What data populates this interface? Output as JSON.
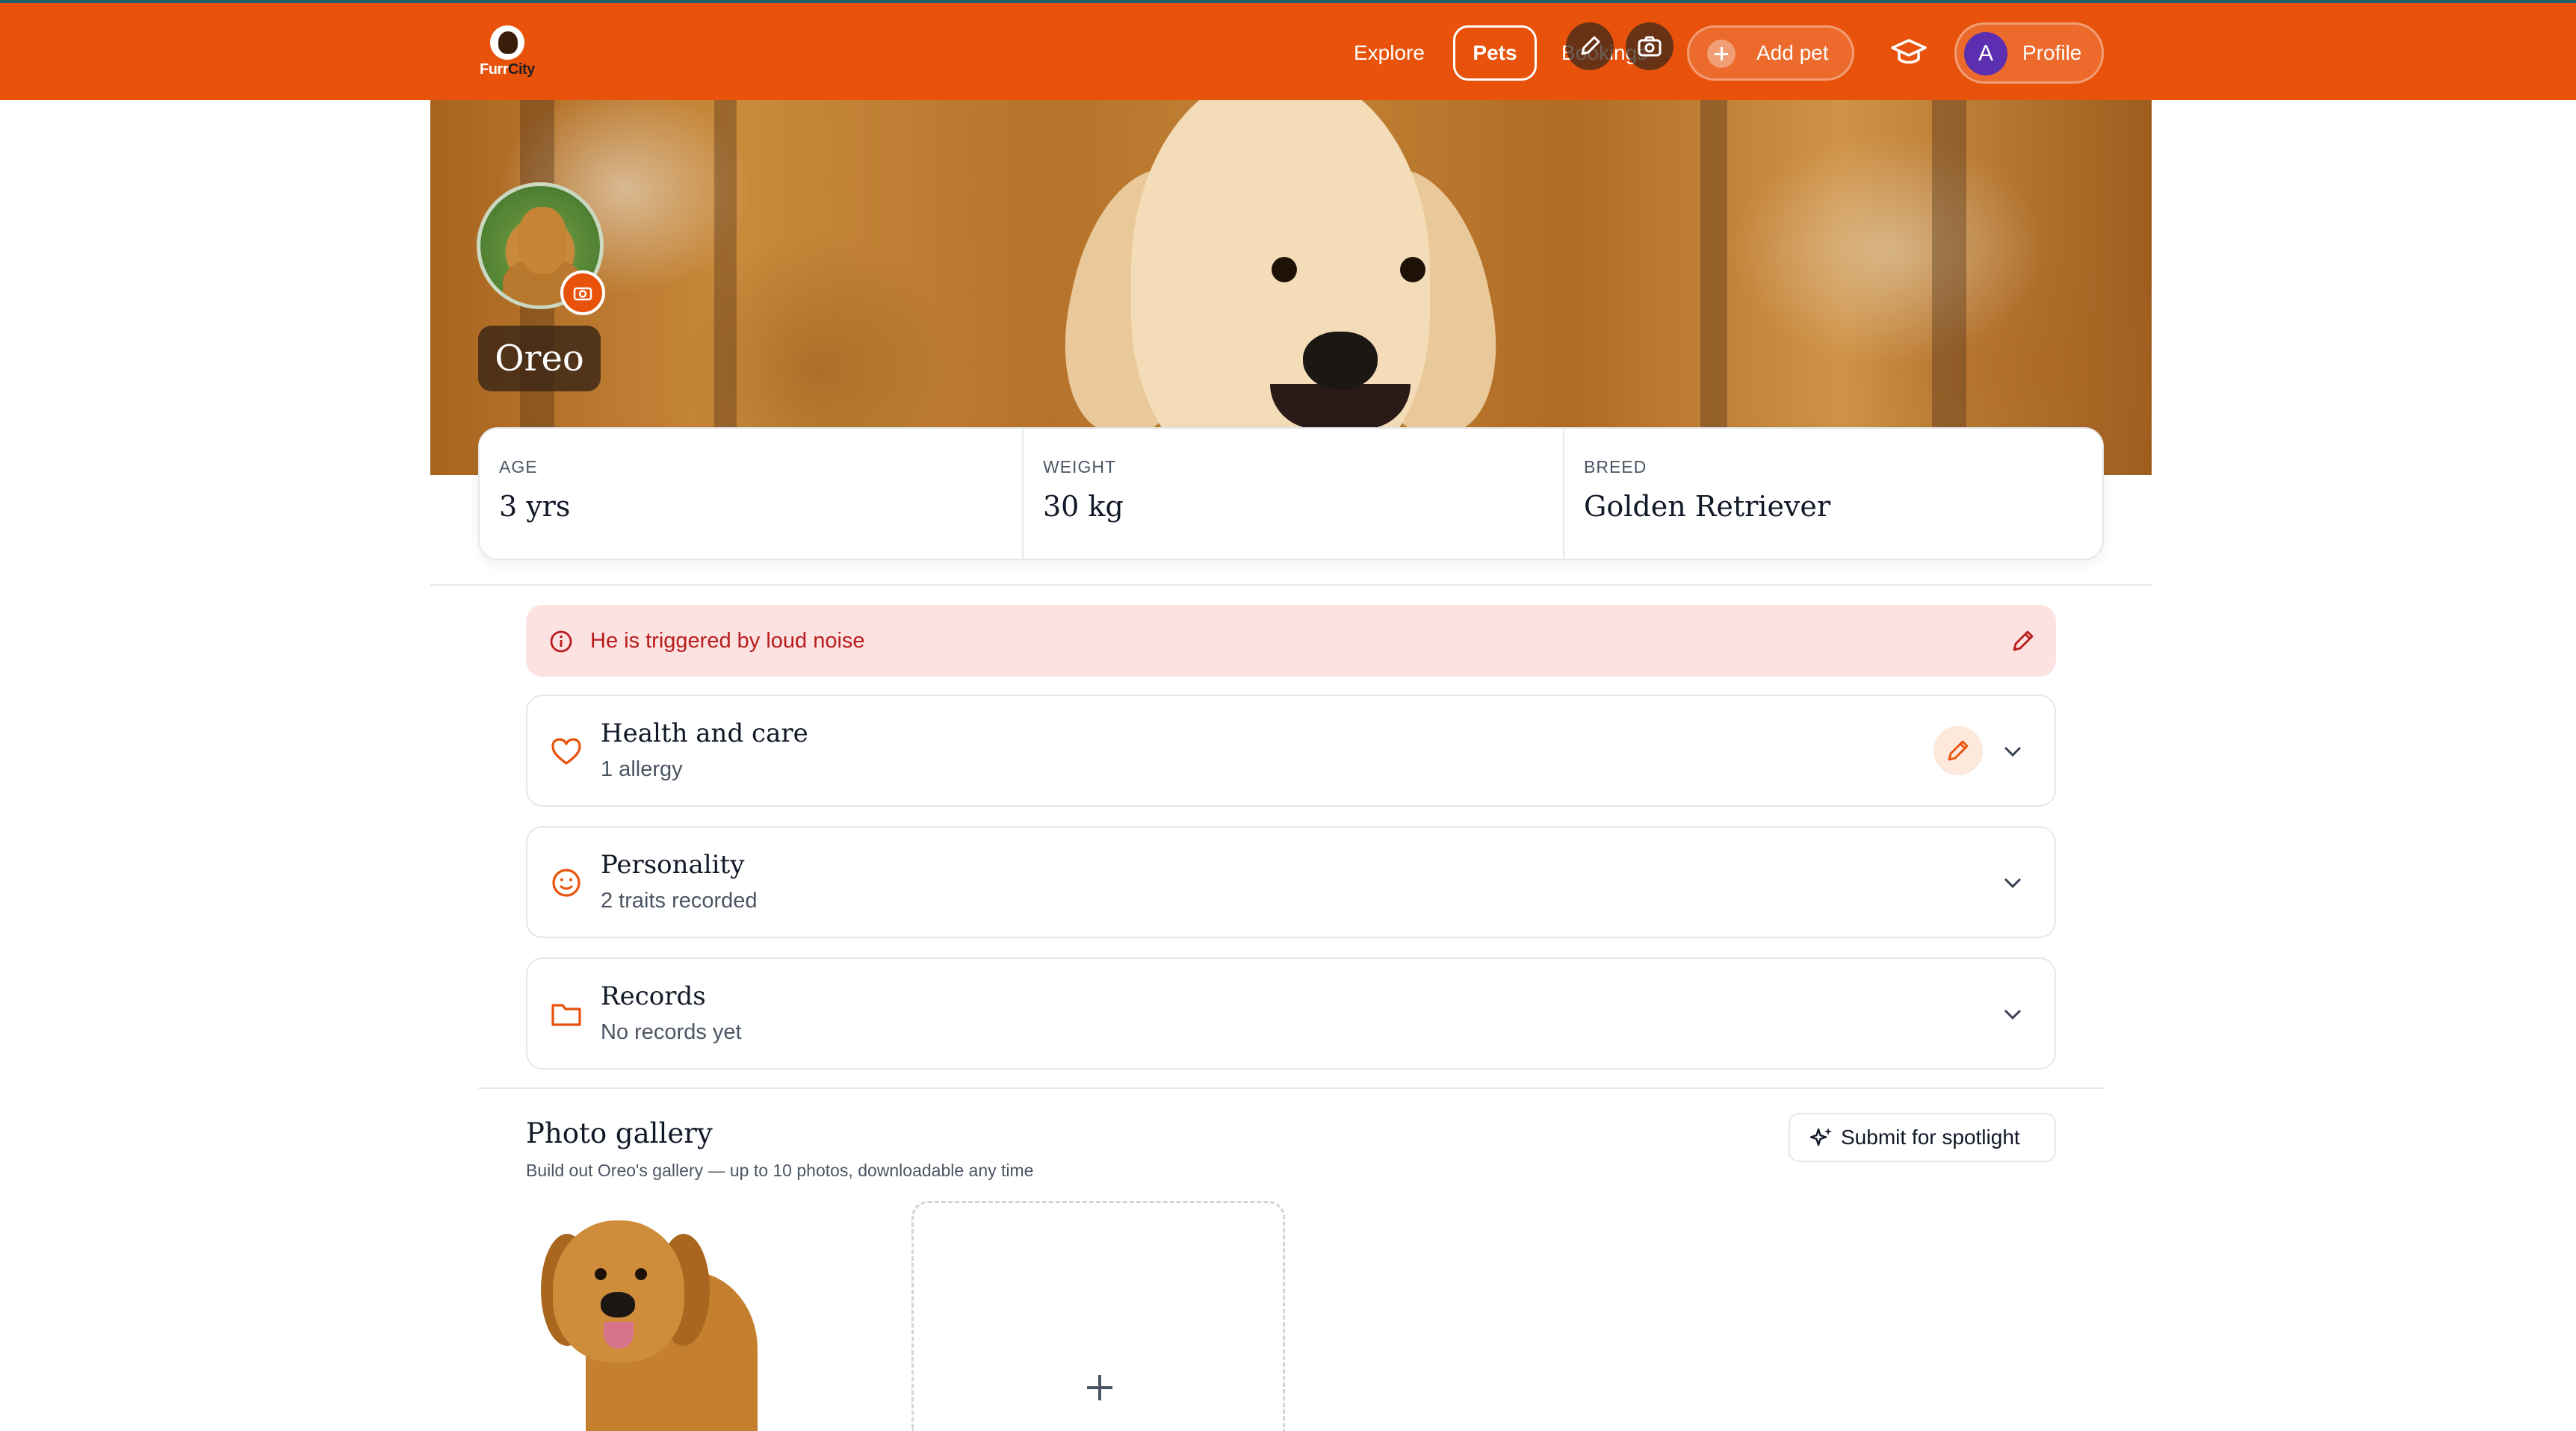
{
  "brand": {
    "name_part1": "Furr",
    "name_part2": "City",
    "accent": "#e8520a"
  },
  "nav": {
    "explore": "Explore",
    "pets": "Pets",
    "bookings": "Bookings",
    "add_pet": "Add pet",
    "profile_initial": "A",
    "profile": "Profile"
  },
  "pet": {
    "name": "Oreo",
    "stats": [
      {
        "label": "AGE",
        "value": "3 yrs"
      },
      {
        "label": "WEIGHT",
        "value": "30 kg"
      },
      {
        "label": "BREED",
        "value": "Golden Retriever"
      }
    ]
  },
  "alert": {
    "text": "He is triggered by loud noise",
    "color": "#b91c1c"
  },
  "sections": [
    {
      "title": "Health and care",
      "subtitle": "1 allergy",
      "icon": "heart-icon"
    },
    {
      "title": "Personality",
      "subtitle": "2 traits recorded",
      "icon": "smiley-icon"
    },
    {
      "title": "Records",
      "subtitle": "No records yet",
      "icon": "folder-icon"
    }
  ],
  "gallery": {
    "title": "Photo gallery",
    "subtitle": "Build out Oreo's gallery — up to 10 photos, downloadable any time",
    "spotlight_button": "Submit for spotlight"
  }
}
